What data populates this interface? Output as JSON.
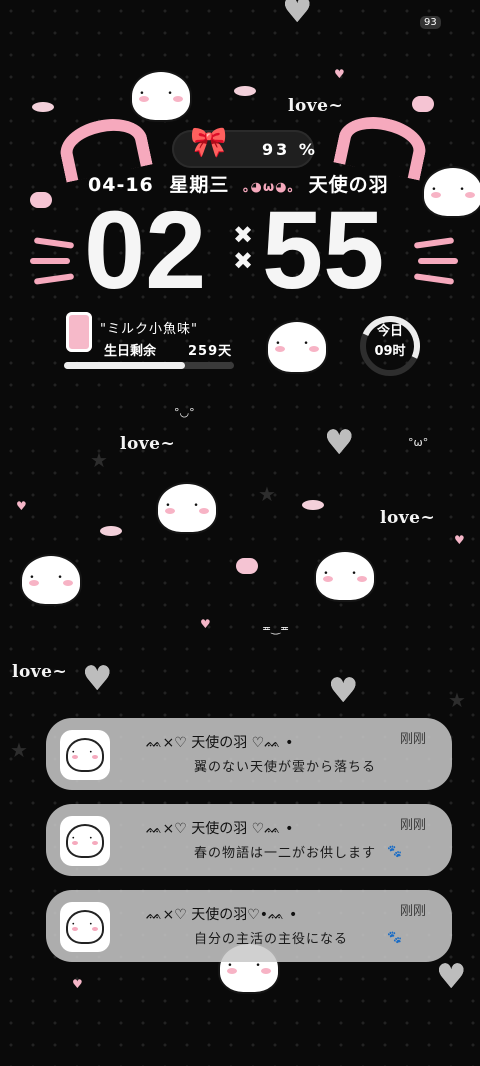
{
  "status": {
    "battery_percent": "93 %",
    "date": "04-16",
    "weekday": "星期三",
    "face": "｡◕ω◕｡",
    "nickname": "天使の羽"
  },
  "clock": {
    "hour": "02",
    "minute": "55",
    "separator": "×\n×"
  },
  "birthday": {
    "title": "\"ミルク小魚味\"",
    "label": "生日剩余",
    "days": "259天",
    "progress": 0.71
  },
  "day_ring": {
    "line1": "今日",
    "line2": "09时",
    "progress": 0.375
  },
  "decor": {
    "love": "love~",
    "mini_text": "93",
    "emotes": [
      "°◡°",
      "≖‿≖",
      "°ω°"
    ]
  },
  "notifications": [
    {
      "title": "ᨐ×♡ 天使の羽 ♡ᨐ •",
      "body": "翼のない天使が雲から落ちる",
      "time": "刚刚"
    },
    {
      "title": "ᨐ×♡ 天使の羽 ♡ᨐ •",
      "body": "春の物語は一二がお供します",
      "time": "刚刚"
    },
    {
      "title": "ᨐ×♡ 天使の羽♡•ᨐ •",
      "body": "自分の主活の主役になる",
      "time": "刚刚"
    }
  ],
  "colors": {
    "background": "#0a0a0a",
    "accent_pink": "#f6a9bd",
    "notification_bg": "#c8c8c8"
  }
}
